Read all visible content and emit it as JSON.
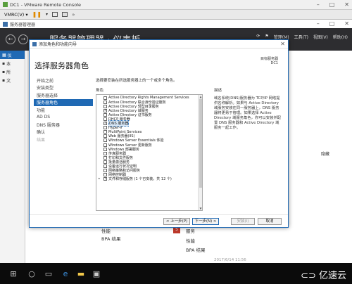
{
  "vmrc": {
    "title": "DC1 - VMware Remote Console",
    "menu_vmrc": "VMRC(V) ▾",
    "play_icon": "pause-icon"
  },
  "server_manager": {
    "title": "服务器管理器",
    "header_title": "服务器管理器 · 仪表板",
    "menu": [
      "管理(M)",
      "工具(T)",
      "视图(V)",
      "帮助(H)"
    ],
    "left_items": [
      "仪",
      "本",
      "所",
      "文"
    ]
  },
  "background": {
    "tile_badge": "5",
    "service_label": "服务",
    "perf_left": "性能",
    "bpa_left": "BPA 结果",
    "perf_right": "性能",
    "bpa_right": "BPA 结果",
    "hide_label": "隐藏",
    "timestamp": "2017/6/14 11:56"
  },
  "wizard": {
    "title": "添加角色和功能向导",
    "heading": "选择服务器角色",
    "dest_label": "目标服务器",
    "dest_value": "DC1",
    "nav": [
      {
        "label": "开始之前",
        "state": "normal"
      },
      {
        "label": "安装类型",
        "state": "normal"
      },
      {
        "label": "服务器选择",
        "state": "normal"
      },
      {
        "label": "服务器角色",
        "state": "selected"
      },
      {
        "label": "功能",
        "state": "normal"
      },
      {
        "label": "AD DS",
        "state": "normal"
      },
      {
        "label": "DNS 服务器",
        "state": "normal"
      },
      {
        "label": "确认",
        "state": "normal"
      },
      {
        "label": "结果",
        "state": "disabled"
      }
    ],
    "description_prompt": "选择要安装在所选服务器上的一个或多个角色。",
    "roles_label": "角色",
    "roles": [
      {
        "label": "Active Directory Rights Management Services",
        "checked": false
      },
      {
        "label": "Active Directory 联合身份验证服务",
        "checked": false
      },
      {
        "label": "Active Directory 轻型目录服务",
        "checked": false
      },
      {
        "label": "Active Directory 域服务",
        "checked": true
      },
      {
        "label": "Active Directory 证书服务",
        "checked": false
      },
      {
        "label": "DHCP 服务器",
        "checked": false
      },
      {
        "label": "DNS 服务器",
        "checked": true,
        "selected": true
      },
      {
        "label": "Hyper-V",
        "checked": false
      },
      {
        "label": "MultiPoint Services",
        "checked": false
      },
      {
        "label": "Web 服务器(IIS)",
        "checked": false
      },
      {
        "label": "Windows Server Essentials 体验",
        "checked": false
      },
      {
        "label": "Windows Server 更新服务",
        "checked": false
      },
      {
        "label": "Windows 部署服务",
        "checked": false
      },
      {
        "label": "传真服务器",
        "checked": false
      },
      {
        "label": "打印和文件服务",
        "checked": false
      },
      {
        "label": "批量激活服务",
        "checked": false
      },
      {
        "label": "设备运行状况证明",
        "checked": false
      },
      {
        "label": "网络策略和访问服务",
        "checked": false
      },
      {
        "label": "网络控制器",
        "checked": false
      },
      {
        "label": "文件和存储服务 (1 个已安装，共 12 个)",
        "checked": "partial",
        "expandable": true
      }
    ],
    "desc_label": "描述",
    "desc_text": "域名系统(DNS)服务器为 TCP/IP 网络提供名称解析。如果与 Active Directory 域服务安装在同一服务器上，DNS 服务器将更易于管理。如果选择 Active Directory 域服务角色，你可以安装并配置 DNS 服务器和 Active Directory 域服务一起工作。",
    "buttons": {
      "prev": "< 上一步(P)",
      "next": "下一步(N) >",
      "install": "安装(I)",
      "cancel": "取消"
    }
  },
  "taskbar": {
    "brand": "亿速云"
  }
}
